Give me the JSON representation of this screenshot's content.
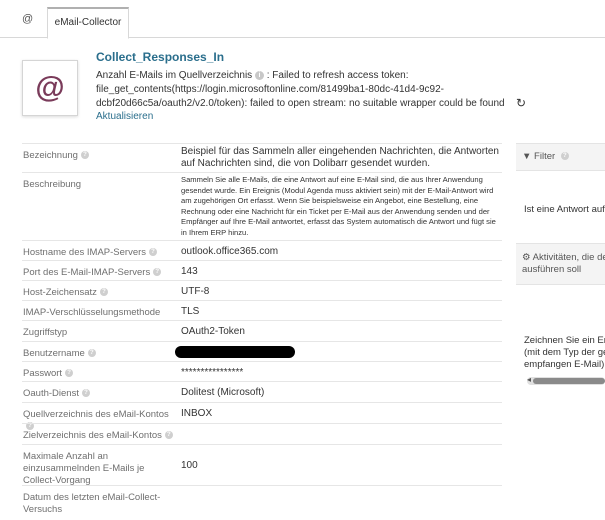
{
  "tabs": {
    "icon_tab": "@",
    "active_tab": "eMail-Collector"
  },
  "header": {
    "avatar_symbol": "@",
    "title": "Collect_Responses_In",
    "mail_count_label": "Anzahl E-Mails im Quellverzeichnis",
    "error_line1": ": Failed to refresh access token:",
    "error_line2": "file_get_contents(https://login.microsoftonline.com/81499ba1-80dc-41d4-9c92-",
    "error_line3": "dcbf20d66c5a/oauth2/v2.0/token): failed to open stream: no suitable wrapper could be found",
    "refresh_label": "Aktualisieren"
  },
  "fields": {
    "bezeichnung": {
      "label": "Bezeichnung",
      "value": "Beispiel für das Sammeln aller eingehenden Nachrichten, die Antworten auf Nachrichten sind, die von Dolibarr gesendet wurden."
    },
    "beschreibung": {
      "label": "Beschreibung",
      "value": "Sammeln Sie alle E-Mails, die eine Antwort auf eine E-Mail sind, die aus Ihrer Anwendung gesendet wurde. Ein Ereignis (Modul Agenda muss aktiviert sein) mit der E-Mail-Antwort wird am zugehörigen Ort erfasst. Wenn Sie beispielsweise ein Angebot, eine Bestellung, eine Rechnung oder eine Nachricht für ein Ticket per E-Mail aus der Anwendung senden und der Empfänger auf Ihre E-Mail antwortet, erfasst das System automatisch die Antwort und fügt sie in Ihrem ERP hinzu."
    },
    "hostname": {
      "label": "Hostname des IMAP-Servers",
      "value": "outlook.office365.com"
    },
    "port": {
      "label": "Port des E-Mail-IMAP-Servers",
      "value": "143"
    },
    "charset": {
      "label": "Host-Zeichensatz",
      "value": "UTF-8"
    },
    "encryption": {
      "label": "IMAP-Verschlüsselungsmethode",
      "value": "TLS"
    },
    "access_type": {
      "label": "Zugriffstyp",
      "value": "OAuth2-Token"
    },
    "username": {
      "label": "Benutzername",
      "value": ""
    },
    "password": {
      "label": "Passwort",
      "value": "****************"
    },
    "oauth": {
      "label": "Oauth-Dienst",
      "value": "Dolitest (Microsoft)"
    },
    "source_dir": {
      "label": "Quellverzeichnis des eMail-Kontos",
      "value": "INBOX"
    },
    "target_dir": {
      "label": "Zielverzeichnis des eMail-Kontos",
      "value": ""
    },
    "max_mails": {
      "label": "Maximale Anzahl an einzusammelnden E-Mails je Collect-Vorgang",
      "value": "100"
    },
    "last_collect": {
      "label": "Datum des letzten eMail-Collect-Versuchs",
      "value": ""
    }
  },
  "right_panel": {
    "filter_label": "Filter",
    "filter_text": "Ist eine Antwort auf e",
    "actions_line1": "Aktivitäten, die de",
    "actions_line2": "ausführen soll",
    "desc_line1": "Zeichnen Sie ein Ere",
    "desc_line2": "(mit dem Typ der ge",
    "desc_line3": "empfangen E-Mail)"
  }
}
